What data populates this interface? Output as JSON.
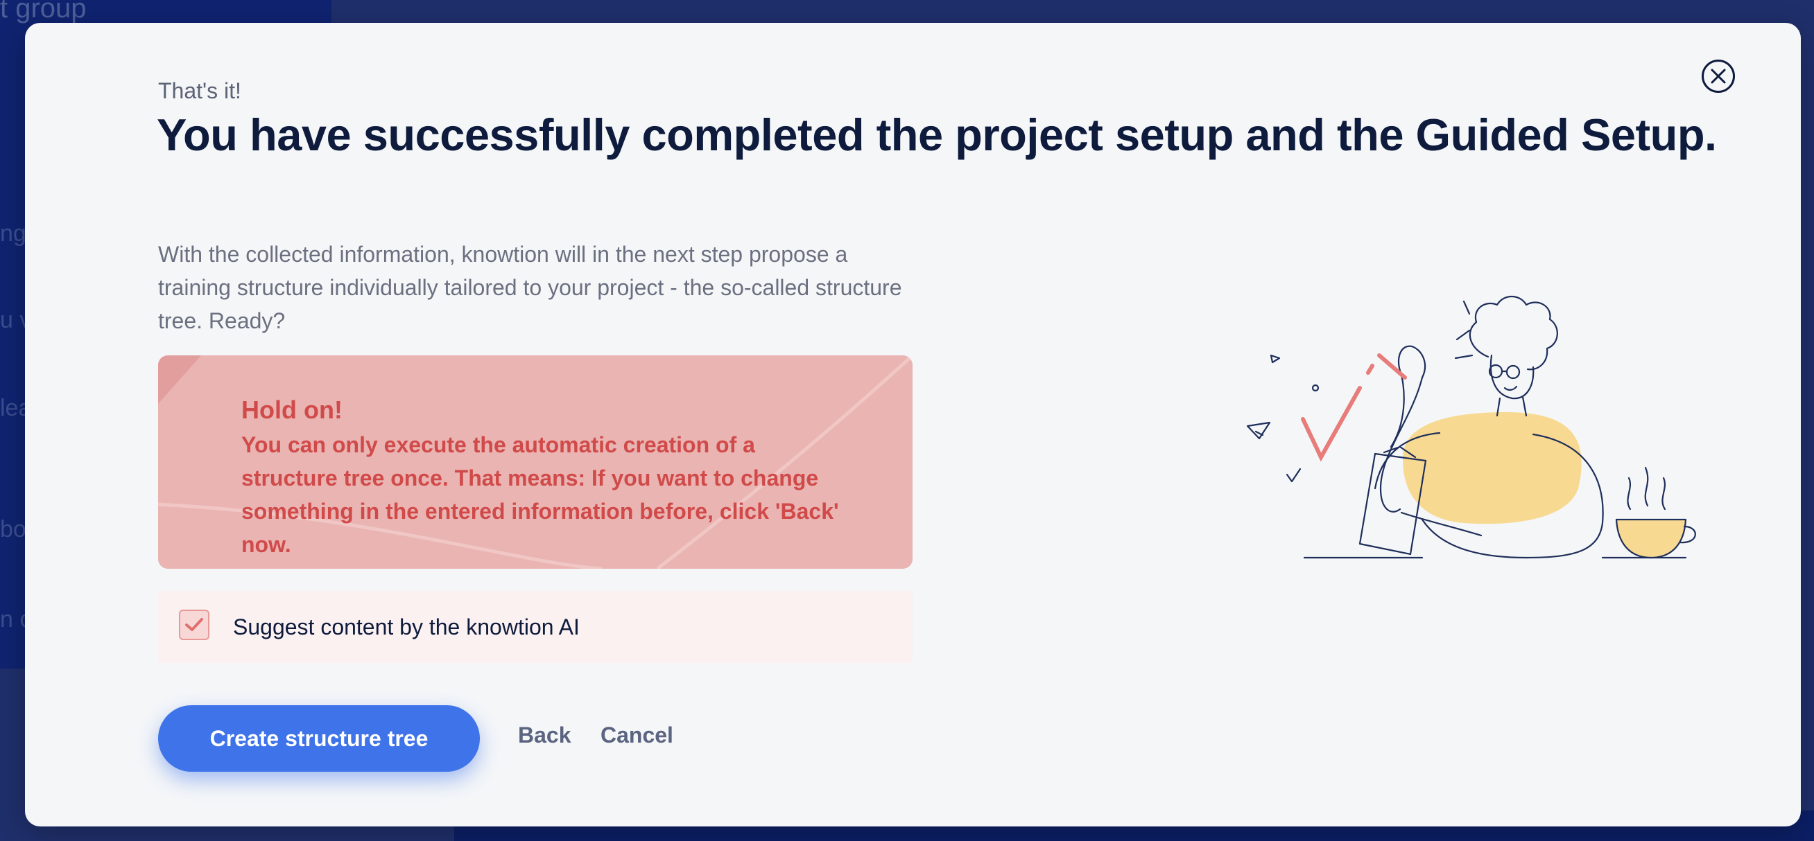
{
  "background": {
    "title_fragment": "t group",
    "snippets": [
      "ng",
      "u v",
      "lea",
      "bo",
      "n c"
    ]
  },
  "modal": {
    "eyebrow": "That's it!",
    "headline": "You have successfully completed the project setup and the Guided Setup.",
    "intro": "With the collected information, knowtion will in the next step propose a training structure individually tailored to your project - the so-called structure tree. Ready?",
    "warning": {
      "title": "Hold on!",
      "text": "You can only execute the automatic creation of a structure tree once. That means: If you want to change something in the entered information before, click 'Back' now."
    },
    "checkbox": {
      "label": "Suggest content by the knowtion AI",
      "checked": true
    },
    "actions": {
      "primary_label": "Create structure tree",
      "back_label": "Back",
      "cancel_label": "Cancel"
    },
    "colors": {
      "headline": "#0e1b3d",
      "warning_bg": "#e9b4b2",
      "warning_text": "#d14a4a",
      "primary": "#3f73ea",
      "accent_yellow": "#f8d992"
    },
    "icons": [
      "close-icon",
      "checkmark-icon",
      "person-illustration"
    ]
  }
}
